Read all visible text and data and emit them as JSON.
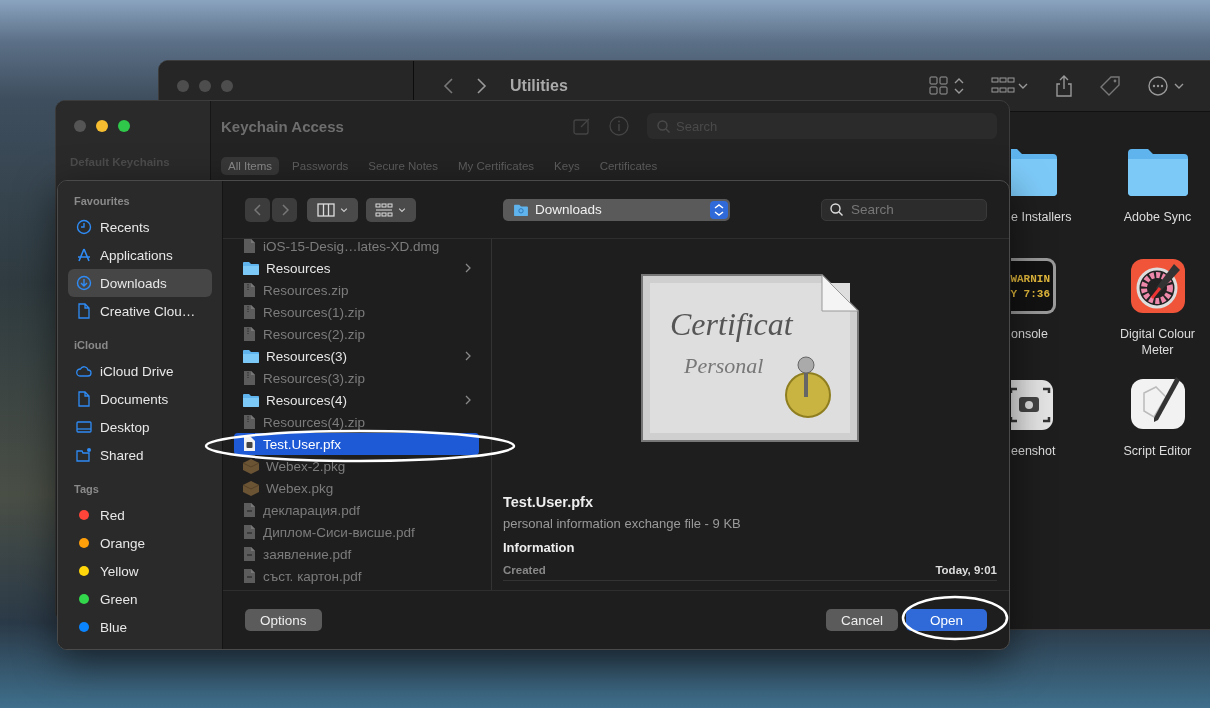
{
  "finder_window": {
    "title": "Utilities",
    "items": [
      {
        "label": "e Installers",
        "kind": "folder"
      },
      {
        "label": "Adobe Sync",
        "kind": "folder"
      },
      {
        "label": "onsole",
        "kind": "console",
        "icon_lines": [
          "WARNIN",
          "Y 7:36"
        ]
      },
      {
        "label": "Digital Colour Meter",
        "kind": "colour-meter"
      },
      {
        "label": "eenshot",
        "kind": "screenshot"
      },
      {
        "label": "Script Editor",
        "kind": "script-editor"
      }
    ]
  },
  "keychain_window": {
    "title": "Keychain Access",
    "sidebar_heading": "Default Keychains",
    "search": {
      "placeholder": "Search"
    },
    "tabs": [
      {
        "label": "All Items",
        "selected": true
      },
      {
        "label": "Passwords",
        "selected": false
      },
      {
        "label": "Secure Notes",
        "selected": false
      },
      {
        "label": "My Certificates",
        "selected": false
      },
      {
        "label": "Keys",
        "selected": false
      },
      {
        "label": "Certificates",
        "selected": false
      }
    ]
  },
  "open_dialog": {
    "sidebar": [
      {
        "heading": "Favourites",
        "items": [
          {
            "label": "Recents",
            "kind": "clock",
            "selected": false
          },
          {
            "label": "Applications",
            "kind": "apps",
            "selected": false
          },
          {
            "label": "Downloads",
            "kind": "download",
            "selected": true
          },
          {
            "label": "Creative Clou…",
            "kind": "document",
            "selected": false
          }
        ]
      },
      {
        "heading": "iCloud",
        "items": [
          {
            "label": "iCloud Drive",
            "kind": "cloud",
            "selected": false
          },
          {
            "label": "Documents",
            "kind": "document",
            "selected": false
          },
          {
            "label": "Desktop",
            "kind": "desktop",
            "selected": false
          },
          {
            "label": "Shared",
            "kind": "shared",
            "selected": false
          }
        ]
      },
      {
        "heading": "Tags",
        "items": [
          {
            "label": "Red",
            "color": "#ff453a",
            "selected": false
          },
          {
            "label": "Orange",
            "color": "#ff9f0a",
            "selected": false
          },
          {
            "label": "Yellow",
            "color": "#ffd60a",
            "selected": false
          },
          {
            "label": "Green",
            "color": "#32d74b",
            "selected": false
          },
          {
            "label": "Blue",
            "color": "#0a84ff",
            "selected": false
          }
        ]
      }
    ],
    "location": "Downloads",
    "search": {
      "placeholder": "Search"
    },
    "files": [
      {
        "name": "iOS-15-Desig…lates-XD.dmg",
        "kind": "document",
        "disabled": true,
        "selected": false
      },
      {
        "name": "Resources",
        "kind": "folder",
        "disabled": false,
        "selected": false
      },
      {
        "name": "Resources.zip",
        "kind": "archive",
        "disabled": true,
        "selected": false
      },
      {
        "name": "Resources(1).zip",
        "kind": "archive",
        "disabled": true,
        "selected": false
      },
      {
        "name": "Resources(2).zip",
        "kind": "archive",
        "disabled": true,
        "selected": false
      },
      {
        "name": "Resources(3)",
        "kind": "folder",
        "disabled": false,
        "selected": false
      },
      {
        "name": "Resources(3).zip",
        "kind": "archive",
        "disabled": true,
        "selected": false
      },
      {
        "name": "Resources(4)",
        "kind": "folder",
        "disabled": false,
        "selected": false
      },
      {
        "name": "Resources(4).zip",
        "kind": "archive",
        "disabled": true,
        "selected": false
      },
      {
        "name": "Test.User.pfx",
        "kind": "certificate",
        "disabled": false,
        "selected": true
      },
      {
        "name": "Webex-2.pkg",
        "kind": "package",
        "disabled": true,
        "selected": false
      },
      {
        "name": "Webex.pkg",
        "kind": "package",
        "disabled": true,
        "selected": false
      },
      {
        "name": "декларация.pdf",
        "kind": "pdf",
        "disabled": true,
        "selected": false
      },
      {
        "name": "Диплом-Сиси-висше.pdf",
        "kind": "pdf",
        "disabled": true,
        "selected": false
      },
      {
        "name": "заявление.pdf",
        "kind": "pdf",
        "disabled": true,
        "selected": false
      },
      {
        "name": "съст. картон.pdf",
        "kind": "pdf",
        "disabled": true,
        "selected": false
      }
    ],
    "preview": {
      "icon_lines": [
        "Certificat",
        "Personal"
      ],
      "name": "Test.User.pfx",
      "description": "personal information exchange file - 9 KB",
      "section": "Information",
      "fields": [
        {
          "label": "Created",
          "value": "Today, 9:01"
        }
      ]
    },
    "buttons": [
      {
        "label": "Options",
        "kind": "secondary"
      },
      {
        "label": "Cancel",
        "kind": "secondary"
      },
      {
        "label": "Open",
        "kind": "primary"
      }
    ]
  }
}
